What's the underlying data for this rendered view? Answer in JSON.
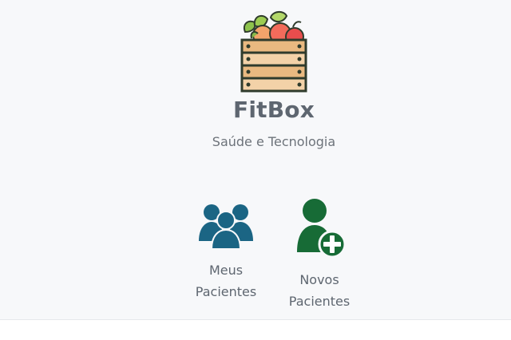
{
  "brand": {
    "title": "FitBox",
    "subtitle": "Saúde e Tecnologia",
    "logo_icon": "fruit-crate-icon"
  },
  "actions": [
    {
      "id": "meus-pacientes",
      "line1": "Meus",
      "line2": "Pacientes",
      "icon": "users-group-icon",
      "color": "#1b6584"
    },
    {
      "id": "novos-pacientes",
      "line1": "Novos",
      "line2": "Pacientes",
      "icon": "user-add-icon",
      "color": "#176b36"
    }
  ],
  "colors": {
    "background": "#f7f8fa",
    "title_text": "#5e6670",
    "subtitle_text": "#6d737a"
  }
}
